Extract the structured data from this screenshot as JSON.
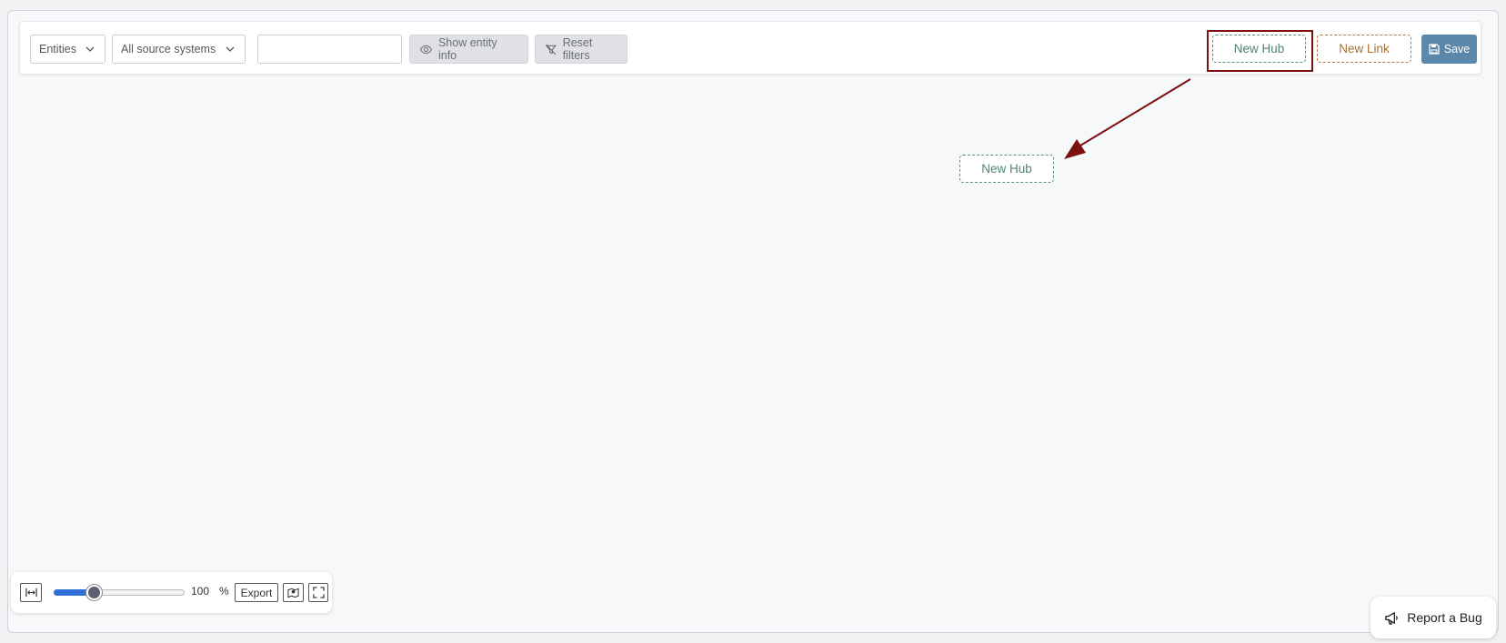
{
  "toolbar": {
    "entity_select": "Entities",
    "source_select": "All source systems",
    "search_value": "",
    "show_entity_info": "Show entity info",
    "reset_filters": "Reset filters",
    "new_hub": "New Hub",
    "new_link": "New Link",
    "save": "Save"
  },
  "canvas": {
    "hub_node": "New Hub"
  },
  "zoom": {
    "level": "100",
    "unit": "%",
    "fraction": 0.3,
    "export": "Export"
  },
  "report_bug": "Report a Bug",
  "colors": {
    "hub": "#5d8f83",
    "link": "#b47a45",
    "save": "#5b87aa",
    "highlight": "#7a1010",
    "slider": "#2f6fd6"
  },
  "icons": {
    "eye": "eye-icon",
    "filter_reset": "filter-off-icon",
    "save": "floppy-disk-icon",
    "fit": "fit-width-icon",
    "minimap": "map-icon",
    "fullscreen": "fullscreen-icon",
    "bug": "megaphone-icon"
  }
}
